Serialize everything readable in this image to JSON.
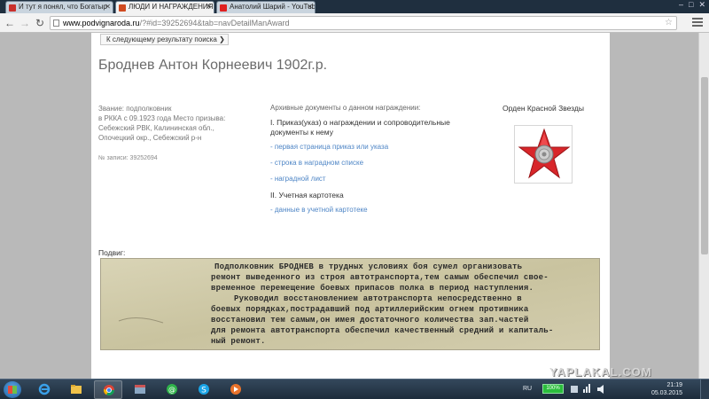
{
  "browser": {
    "tabs": [
      {
        "label": "И тут я понял, что Богатыр",
        "favicon_color": "#c9302c",
        "active": false
      },
      {
        "label": "ЛЮДИ И НАГРАЖДЕНИЯ",
        "favicon_color": "#d04a1f",
        "active": true
      },
      {
        "label": "Анатолий Шарий - YouTube",
        "favicon_color": "#e02020",
        "active": false
      }
    ],
    "address_host": "www.podvignaroda.ru",
    "address_rest": "/?#id=39252694&tab=navDetailManAward"
  },
  "page": {
    "next_result_label": "К следующему результату поиска",
    "person_title": "Броднев Антон Корнеевич 1902г.р.",
    "rank_lines": [
      "Звание: подполковник",
      "в РККА с 09.1923 года Место призыва:",
      "Себежский РВК, Калининская обл.,",
      "Опочецкий окр., Себежский р-н"
    ],
    "record_no": "№ записи: 39252694",
    "docs_heading": "Архивные документы о данном награждении:",
    "section1": "I. Приказ(указ) о награждении и сопроводительные документы к нему",
    "links1": [
      "- первая страница приказ или указа",
      "- строка в наградном списке",
      "- наградной лист"
    ],
    "section2": "II. Учетная картотека",
    "links2": [
      "- данные в учетной картотеке"
    ],
    "award_title": "Орден Красной Звезды",
    "feat_label": "Подвиг:",
    "scan_lines": [
      "Подполковник БРОДНЕВ в трудных условиях боя сумел организовать",
      "ремонт выведенного из строя автотранспорта,тем самым обеспечил свое-",
      "временное перемещение боевых припасов полка в период наступления.",
      "Руководил восстановлением автотранспорта непосредственно в",
      "боевых порядках,пострадавший под артиллерийским огнем противника",
      "восстановил тем самым,он имея достаточного количества зап.частей",
      "для ремонта автотранспорта обеспечил качественный средний и капиталь-",
      "ный ремонт."
    ]
  },
  "watermark": "YAPLAKAL.COM",
  "taskbar": {
    "language": "RU",
    "battery": "100%",
    "time": "21:19",
    "date": "05.03.2015"
  }
}
